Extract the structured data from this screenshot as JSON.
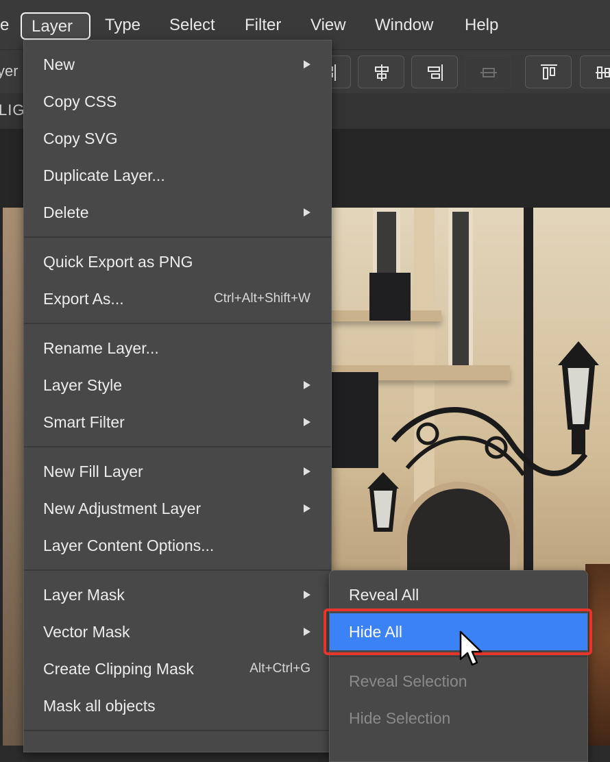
{
  "menubar": {
    "items": [
      "e",
      "Layer",
      "Type",
      "Select",
      "Filter",
      "View",
      "Window",
      "Help"
    ],
    "active": "Layer"
  },
  "options_bar": {
    "left_label": "yer"
  },
  "tabs": {
    "first_label": "LIGI"
  },
  "layer_menu": {
    "items": [
      {
        "label": "New",
        "submenu": true
      },
      {
        "label": "Copy CSS"
      },
      {
        "label": "Copy SVG"
      },
      {
        "label": "Duplicate Layer..."
      },
      {
        "label": "Delete",
        "submenu": true
      },
      {
        "label": "Quick Export as PNG"
      },
      {
        "label": "Export As...",
        "shortcut": "Ctrl+Alt+Shift+W"
      },
      {
        "label": "Rename Layer..."
      },
      {
        "label": "Layer Style",
        "submenu": true
      },
      {
        "label": "Smart Filter",
        "submenu": true
      },
      {
        "label": "New Fill Layer",
        "submenu": true
      },
      {
        "label": "New Adjustment Layer",
        "submenu": true
      },
      {
        "label": "Layer Content Options..."
      },
      {
        "label": "Layer Mask",
        "submenu": true
      },
      {
        "label": "Vector Mask",
        "submenu": true
      },
      {
        "label": "Create Clipping Mask",
        "shortcut": "Alt+Ctrl+G"
      },
      {
        "label": "Mask all objects"
      }
    ]
  },
  "layer_mask_submenu": {
    "items": [
      {
        "label": "Reveal All",
        "enabled": true
      },
      {
        "label": "Hide All",
        "enabled": true,
        "highlighted": true
      },
      {
        "label": "Reveal Selection",
        "enabled": false
      },
      {
        "label": "Hide Selection",
        "enabled": false
      }
    ]
  },
  "colors": {
    "highlight": "#3b82f6",
    "annotation": "#e8352c",
    "menu_bg": "#484848",
    "bar_bg": "#3a3a3a"
  },
  "icons": [
    "align-right-icon",
    "align-center-horizontal-icon",
    "align-right-edge-icon",
    "align-middle-disabled-icon",
    "align-top-icon",
    "distribute-icon",
    "submenu-arrow-icon",
    "mouse-pointer-icon"
  ]
}
